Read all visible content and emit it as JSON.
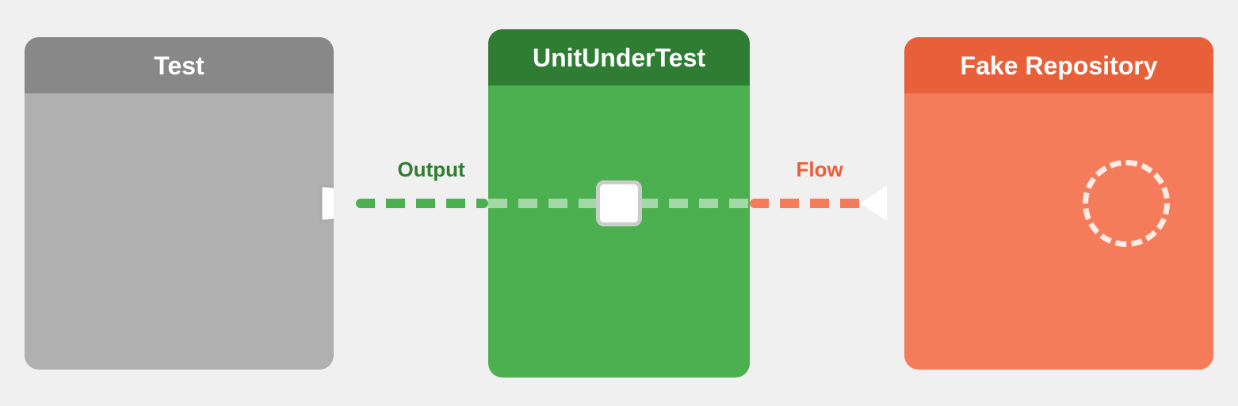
{
  "boxes": {
    "test": {
      "label": "Test",
      "header_bg": "#888888",
      "body_bg": "#b0b0b0"
    },
    "unit": {
      "label": "UnitUnderTest",
      "header_bg": "#2e7d32",
      "body_bg": "#4caf50"
    },
    "fake": {
      "label": "Fake Repository",
      "header_bg": "#e8603a",
      "body_bg": "#f47c5a"
    }
  },
  "connections": {
    "left_label": "Output",
    "right_label": "Flow"
  }
}
